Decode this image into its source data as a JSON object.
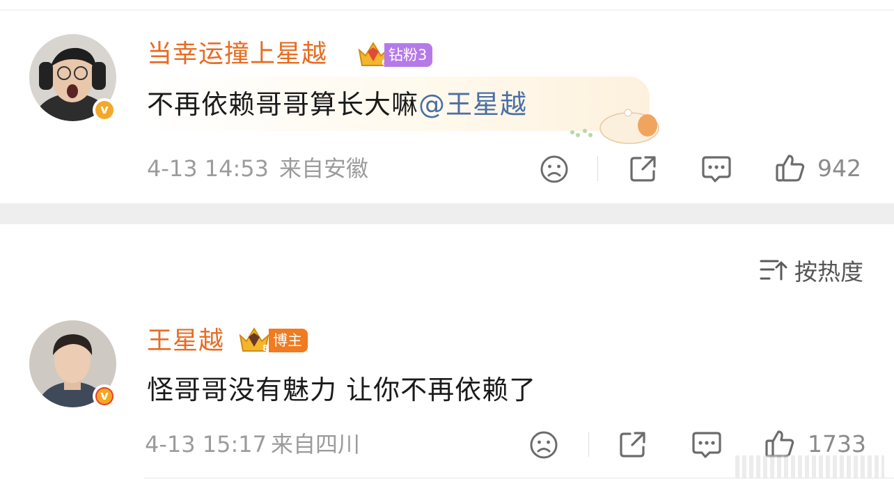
{
  "comments": [
    {
      "username": "当幸运撞上星越",
      "badge": "钻粉3",
      "text": "不再依赖哥哥算长大嘛",
      "mention": "@王星越",
      "date": "4-13 14:53",
      "source": "来自安徽",
      "likes": "942"
    },
    {
      "username": "王星越",
      "badge": "博主",
      "text": "怪哥哥没有魅力 让你不再依赖了",
      "date": "4-13 15:17",
      "source": "来自四川",
      "likes": "1733"
    }
  ],
  "sort": {
    "label": "按热度"
  },
  "colors": {
    "username": "#e86b22",
    "mention": "#4a6fa5",
    "meta": "#9b9b9b",
    "badge_purple": "#b57ae8",
    "badge_orange": "#f07b20"
  },
  "icons": [
    "sad-face-icon",
    "share-icon",
    "comment-icon",
    "thumbs-up-icon",
    "sort-icon",
    "verified-icon",
    "crown-icon"
  ]
}
